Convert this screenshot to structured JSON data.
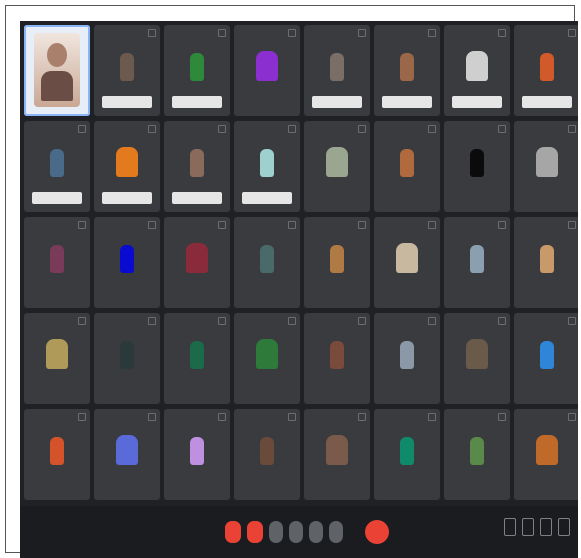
{
  "tiles": [
    {
      "name": "",
      "active": true
    },
    {
      "name": "",
      "color": "#6b5a4d",
      "pill": true
    },
    {
      "name": "",
      "color": "#2e8a3a",
      "pill": true
    },
    {
      "name": "",
      "color": "#8b2fd0"
    },
    {
      "name": "",
      "color": "#7a6e66",
      "pill": true
    },
    {
      "name": "",
      "color": "#9a6748",
      "pill": true
    },
    {
      "name": "",
      "color": "#cfcfcf",
      "pill": true
    },
    {
      "name": "",
      "color": "#d25a2a",
      "pill": true
    },
    {
      "name": "",
      "color": "#4a6a8a",
      "pill": true
    },
    {
      "name": "",
      "color": "#e37a1e",
      "pill": true
    },
    {
      "name": "",
      "color": "#8a6a5a",
      "pill": true
    },
    {
      "name": "",
      "color": "#9fd0d0",
      "pill": true
    },
    {
      "name": "",
      "color": "#9aa690"
    },
    {
      "name": "",
      "color": "#b06a3e"
    },
    {
      "name": "",
      "color": "#0b0b0b"
    },
    {
      "name": "",
      "color": "#a6a6a6"
    },
    {
      "name": "",
      "color": "#7a3b5a"
    },
    {
      "name": "",
      "color": "#0a0ad0"
    },
    {
      "name": "",
      "color": "#8a2a3a"
    },
    {
      "name": "",
      "color": "#4a6a6a"
    },
    {
      "name": "",
      "color": "#b07a45"
    },
    {
      "name": "",
      "color": "#c9b8a0"
    },
    {
      "name": "",
      "color": "#8aa0b0"
    },
    {
      "name": "",
      "color": "#c89a6a"
    },
    {
      "name": "",
      "color": "#b09a5a"
    },
    {
      "name": "",
      "color": "#2a3a3a"
    },
    {
      "name": "",
      "color": "#1b6a4a"
    },
    {
      "name": "",
      "color": "#2e7a3a"
    },
    {
      "name": "",
      "color": "#7a4a3a"
    },
    {
      "name": "",
      "color": "#8a98a8"
    },
    {
      "name": "",
      "color": "#6a5a4a"
    },
    {
      "name": "",
      "color": "#2f86d8"
    },
    {
      "name": "",
      "color": "#d5532a"
    },
    {
      "name": "",
      "color": "#5a6ad8"
    },
    {
      "name": "",
      "color": "#c090e0"
    },
    {
      "name": "",
      "color": "#6a4a3a"
    },
    {
      "name": "",
      "color": "#7a5a4a"
    },
    {
      "name": "",
      "color": "#0f8a6a"
    },
    {
      "name": "",
      "color": "#5a8a4a"
    },
    {
      "name": "",
      "color": "#c06a2a"
    }
  ],
  "bottom": {
    "meeting_info": ""
  }
}
